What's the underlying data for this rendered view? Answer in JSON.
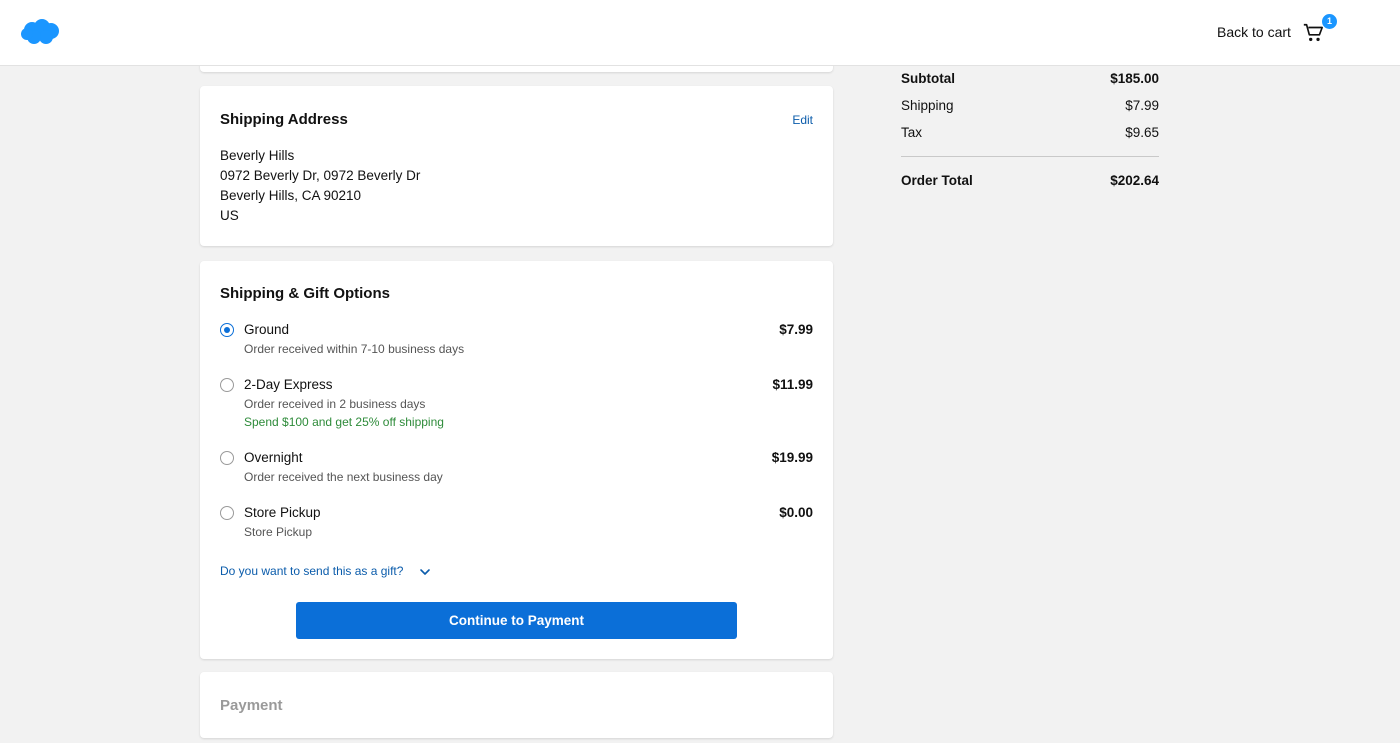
{
  "header": {
    "logo_icon": "salesforce-cloud-logo",
    "back_to_cart": "Back to cart",
    "cart_icon": "shopping-cart-icon",
    "cart_count": "1",
    "brand_color": "#1b96ff"
  },
  "address": {
    "title": "Shipping Address",
    "edit_label": "Edit",
    "lines": [
      "Beverly Hills",
      "0972 Beverly Dr, 0972 Beverly Dr",
      "Beverly Hills, CA 90210",
      "US"
    ]
  },
  "shipping": {
    "title": "Shipping & Gift Options",
    "options": [
      {
        "name": "Ground",
        "desc": "Order received within 7-10 business days",
        "promo": "",
        "price": "$7.99",
        "selected": true
      },
      {
        "name": "2-Day Express",
        "desc": "Order received in 2 business days",
        "promo": "Spend $100 and get 25% off shipping",
        "price": "$11.99",
        "selected": false
      },
      {
        "name": "Overnight",
        "desc": "Order received the next business day",
        "promo": "",
        "price": "$19.99",
        "selected": false
      },
      {
        "name": "Store Pickup",
        "desc": "Store Pickup",
        "promo": "",
        "price": "$0.00",
        "selected": false
      }
    ],
    "gift_prompt": "Do you want to send this as a gift?",
    "continue_label": "Continue to Payment",
    "accent_color": "#0b6fd8"
  },
  "payment": {
    "title": "Payment"
  },
  "summary": {
    "subtotal_label": "Subtotal",
    "subtotal_value": "$185.00",
    "shipping_label": "Shipping",
    "shipping_value": "$7.99",
    "tax_label": "Tax",
    "tax_value": "$9.65",
    "total_label": "Order Total",
    "total_value": "$202.64"
  }
}
